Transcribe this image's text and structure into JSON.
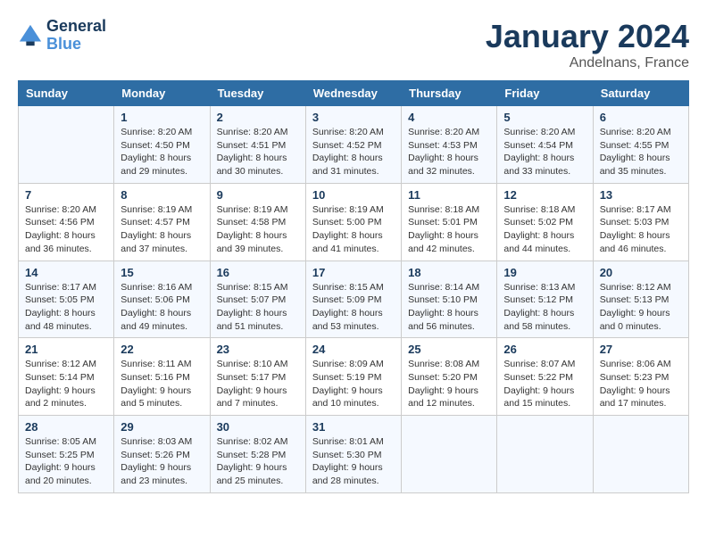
{
  "header": {
    "logo_line1": "General",
    "logo_line2": "Blue",
    "month": "January 2024",
    "location": "Andelnans, France"
  },
  "days_of_week": [
    "Sunday",
    "Monday",
    "Tuesday",
    "Wednesday",
    "Thursday",
    "Friday",
    "Saturday"
  ],
  "weeks": [
    [
      {
        "day": "",
        "sunrise": "",
        "sunset": "",
        "daylight": ""
      },
      {
        "day": "1",
        "sunrise": "Sunrise: 8:20 AM",
        "sunset": "Sunset: 4:50 PM",
        "daylight": "Daylight: 8 hours and 29 minutes."
      },
      {
        "day": "2",
        "sunrise": "Sunrise: 8:20 AM",
        "sunset": "Sunset: 4:51 PM",
        "daylight": "Daylight: 8 hours and 30 minutes."
      },
      {
        "day": "3",
        "sunrise": "Sunrise: 8:20 AM",
        "sunset": "Sunset: 4:52 PM",
        "daylight": "Daylight: 8 hours and 31 minutes."
      },
      {
        "day": "4",
        "sunrise": "Sunrise: 8:20 AM",
        "sunset": "Sunset: 4:53 PM",
        "daylight": "Daylight: 8 hours and 32 minutes."
      },
      {
        "day": "5",
        "sunrise": "Sunrise: 8:20 AM",
        "sunset": "Sunset: 4:54 PM",
        "daylight": "Daylight: 8 hours and 33 minutes."
      },
      {
        "day": "6",
        "sunrise": "Sunrise: 8:20 AM",
        "sunset": "Sunset: 4:55 PM",
        "daylight": "Daylight: 8 hours and 35 minutes."
      }
    ],
    [
      {
        "day": "7",
        "sunrise": "Sunrise: 8:20 AM",
        "sunset": "Sunset: 4:56 PM",
        "daylight": "Daylight: 8 hours and 36 minutes."
      },
      {
        "day": "8",
        "sunrise": "Sunrise: 8:19 AM",
        "sunset": "Sunset: 4:57 PM",
        "daylight": "Daylight: 8 hours and 37 minutes."
      },
      {
        "day": "9",
        "sunrise": "Sunrise: 8:19 AM",
        "sunset": "Sunset: 4:58 PM",
        "daylight": "Daylight: 8 hours and 39 minutes."
      },
      {
        "day": "10",
        "sunrise": "Sunrise: 8:19 AM",
        "sunset": "Sunset: 5:00 PM",
        "daylight": "Daylight: 8 hours and 41 minutes."
      },
      {
        "day": "11",
        "sunrise": "Sunrise: 8:18 AM",
        "sunset": "Sunset: 5:01 PM",
        "daylight": "Daylight: 8 hours and 42 minutes."
      },
      {
        "day": "12",
        "sunrise": "Sunrise: 8:18 AM",
        "sunset": "Sunset: 5:02 PM",
        "daylight": "Daylight: 8 hours and 44 minutes."
      },
      {
        "day": "13",
        "sunrise": "Sunrise: 8:17 AM",
        "sunset": "Sunset: 5:03 PM",
        "daylight": "Daylight: 8 hours and 46 minutes."
      }
    ],
    [
      {
        "day": "14",
        "sunrise": "Sunrise: 8:17 AM",
        "sunset": "Sunset: 5:05 PM",
        "daylight": "Daylight: 8 hours and 48 minutes."
      },
      {
        "day": "15",
        "sunrise": "Sunrise: 8:16 AM",
        "sunset": "Sunset: 5:06 PM",
        "daylight": "Daylight: 8 hours and 49 minutes."
      },
      {
        "day": "16",
        "sunrise": "Sunrise: 8:15 AM",
        "sunset": "Sunset: 5:07 PM",
        "daylight": "Daylight: 8 hours and 51 minutes."
      },
      {
        "day": "17",
        "sunrise": "Sunrise: 8:15 AM",
        "sunset": "Sunset: 5:09 PM",
        "daylight": "Daylight: 8 hours and 53 minutes."
      },
      {
        "day": "18",
        "sunrise": "Sunrise: 8:14 AM",
        "sunset": "Sunset: 5:10 PM",
        "daylight": "Daylight: 8 hours and 56 minutes."
      },
      {
        "day": "19",
        "sunrise": "Sunrise: 8:13 AM",
        "sunset": "Sunset: 5:12 PM",
        "daylight": "Daylight: 8 hours and 58 minutes."
      },
      {
        "day": "20",
        "sunrise": "Sunrise: 8:12 AM",
        "sunset": "Sunset: 5:13 PM",
        "daylight": "Daylight: 9 hours and 0 minutes."
      }
    ],
    [
      {
        "day": "21",
        "sunrise": "Sunrise: 8:12 AM",
        "sunset": "Sunset: 5:14 PM",
        "daylight": "Daylight: 9 hours and 2 minutes."
      },
      {
        "day": "22",
        "sunrise": "Sunrise: 8:11 AM",
        "sunset": "Sunset: 5:16 PM",
        "daylight": "Daylight: 9 hours and 5 minutes."
      },
      {
        "day": "23",
        "sunrise": "Sunrise: 8:10 AM",
        "sunset": "Sunset: 5:17 PM",
        "daylight": "Daylight: 9 hours and 7 minutes."
      },
      {
        "day": "24",
        "sunrise": "Sunrise: 8:09 AM",
        "sunset": "Sunset: 5:19 PM",
        "daylight": "Daylight: 9 hours and 10 minutes."
      },
      {
        "day": "25",
        "sunrise": "Sunrise: 8:08 AM",
        "sunset": "Sunset: 5:20 PM",
        "daylight": "Daylight: 9 hours and 12 minutes."
      },
      {
        "day": "26",
        "sunrise": "Sunrise: 8:07 AM",
        "sunset": "Sunset: 5:22 PM",
        "daylight": "Daylight: 9 hours and 15 minutes."
      },
      {
        "day": "27",
        "sunrise": "Sunrise: 8:06 AM",
        "sunset": "Sunset: 5:23 PM",
        "daylight": "Daylight: 9 hours and 17 minutes."
      }
    ],
    [
      {
        "day": "28",
        "sunrise": "Sunrise: 8:05 AM",
        "sunset": "Sunset: 5:25 PM",
        "daylight": "Daylight: 9 hours and 20 minutes."
      },
      {
        "day": "29",
        "sunrise": "Sunrise: 8:03 AM",
        "sunset": "Sunset: 5:26 PM",
        "daylight": "Daylight: 9 hours and 23 minutes."
      },
      {
        "day": "30",
        "sunrise": "Sunrise: 8:02 AM",
        "sunset": "Sunset: 5:28 PM",
        "daylight": "Daylight: 9 hours and 25 minutes."
      },
      {
        "day": "31",
        "sunrise": "Sunrise: 8:01 AM",
        "sunset": "Sunset: 5:30 PM",
        "daylight": "Daylight: 9 hours and 28 minutes."
      },
      {
        "day": "",
        "sunrise": "",
        "sunset": "",
        "daylight": ""
      },
      {
        "day": "",
        "sunrise": "",
        "sunset": "",
        "daylight": ""
      },
      {
        "day": "",
        "sunrise": "",
        "sunset": "",
        "daylight": ""
      }
    ]
  ]
}
